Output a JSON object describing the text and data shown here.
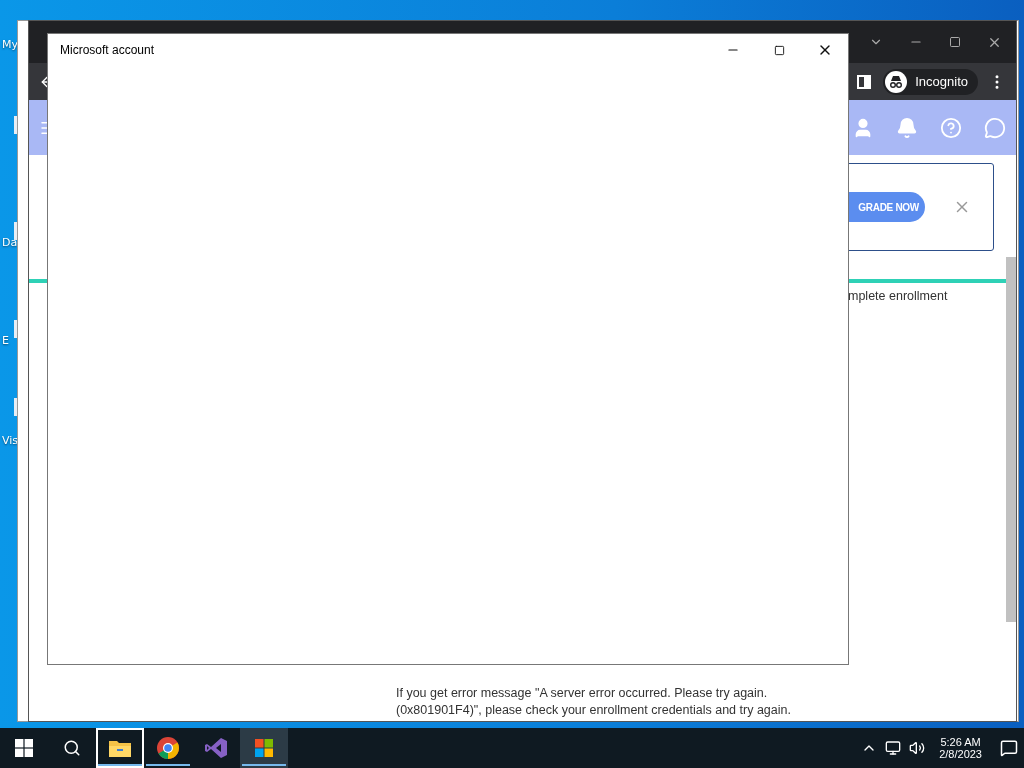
{
  "desktop": {
    "icons": [
      {
        "label": "My"
      },
      {
        "label": "Da"
      },
      {
        "label": "E"
      },
      {
        "label": "Vis"
      }
    ]
  },
  "browser": {
    "profile": "Incognito",
    "banner": {
      "button": "GRADE NOW"
    },
    "page_text": "mplete enrollment",
    "note": [
      "If you get error message \"A server error occurred. Please try again.",
      "(0x801901F4)\", please check your enrollment credentials and try again."
    ]
  },
  "dialog": {
    "title": "Microsoft account"
  },
  "taskbar": {
    "apps": [
      {
        "kind": "explorer",
        "running": true,
        "selected": false,
        "focused": true
      },
      {
        "kind": "chrome",
        "running": true,
        "selected": false,
        "focused": false
      },
      {
        "kind": "studio",
        "running": false,
        "selected": false,
        "focused": false
      },
      {
        "kind": "store",
        "running": true,
        "selected": true,
        "focused": false
      }
    ],
    "time": "5:26 AM",
    "date": "2/8/2023"
  }
}
